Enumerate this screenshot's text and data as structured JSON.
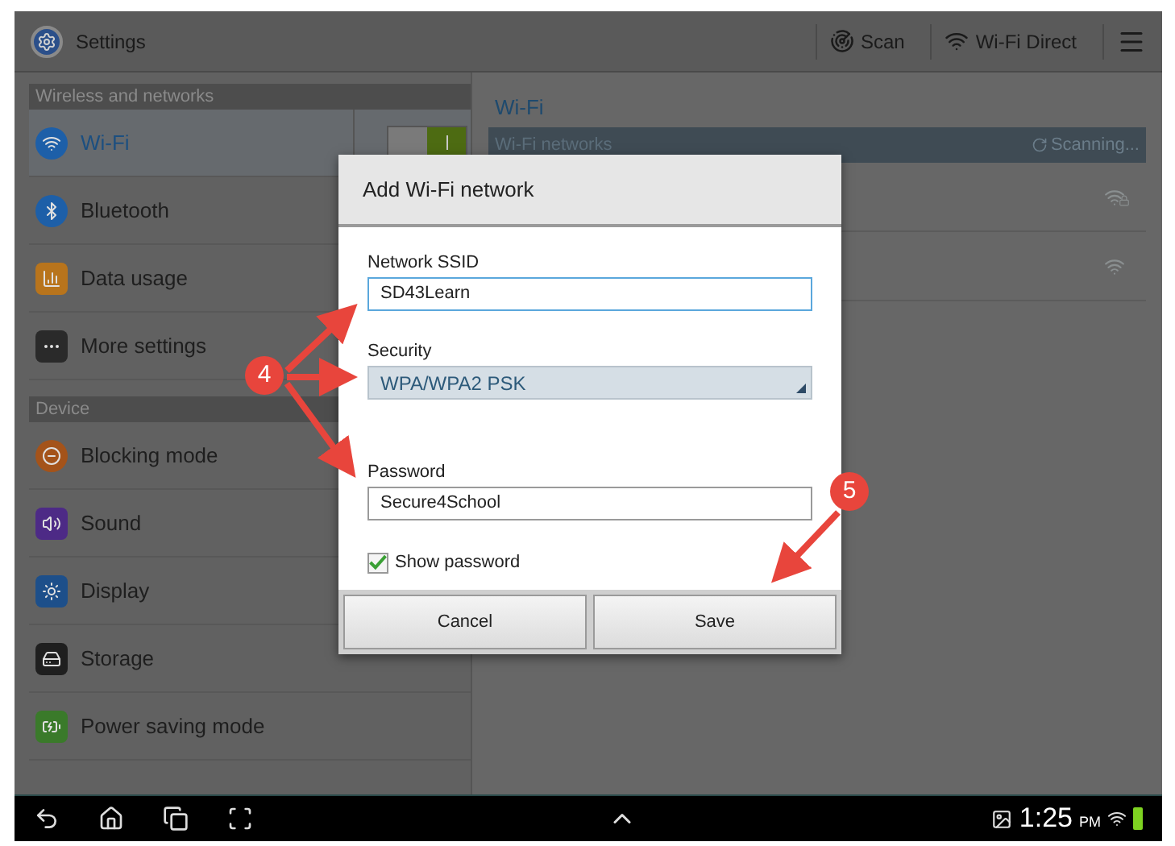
{
  "action_bar": {
    "title": "Settings",
    "actions": [
      {
        "kind": "scan",
        "label": "Scan"
      },
      {
        "kind": "wifi_direct",
        "label": "Wi-Fi Direct"
      }
    ]
  },
  "sidebar": {
    "sections": [
      {
        "header": "Wireless and networks",
        "items": [
          {
            "label": "Wi-Fi",
            "selected": true,
            "toggle": {
              "on": true
            }
          },
          {
            "label": "Bluetooth",
            "selected": false
          },
          {
            "label": "Data usage",
            "selected": false
          },
          {
            "label": "More settings",
            "selected": false
          }
        ]
      },
      {
        "header": "Device",
        "items": [
          {
            "label": "Blocking mode",
            "selected": false
          },
          {
            "label": "Sound",
            "selected": false
          },
          {
            "label": "Display",
            "selected": false
          },
          {
            "label": "Storage",
            "selected": false
          },
          {
            "label": "Power saving mode",
            "selected": false
          }
        ]
      }
    ]
  },
  "detail": {
    "title": "Wi-Fi",
    "section": "Wi-Fi networks",
    "status": "Scanning...",
    "networks": [
      {
        "secured": true
      },
      {
        "secured": false
      }
    ]
  },
  "dialog": {
    "title": "Add Wi-Fi network",
    "fields": [
      {
        "kind": "text",
        "label": "Network SSID",
        "value": "SD43Learn",
        "focused": true
      },
      {
        "kind": "select",
        "label": "Security",
        "value": "WPA/WPA2 PSK"
      },
      {
        "kind": "text",
        "label": "Password",
        "value": "Secure4School",
        "focused": false
      }
    ],
    "checkbox": {
      "label": "Show password",
      "checked": true
    },
    "buttons": [
      "Cancel",
      "Save"
    ]
  },
  "annotations": [
    {
      "label": "4"
    },
    {
      "label": "5"
    }
  ],
  "status_bar": {
    "time": "1:25",
    "ampm": "PM"
  }
}
